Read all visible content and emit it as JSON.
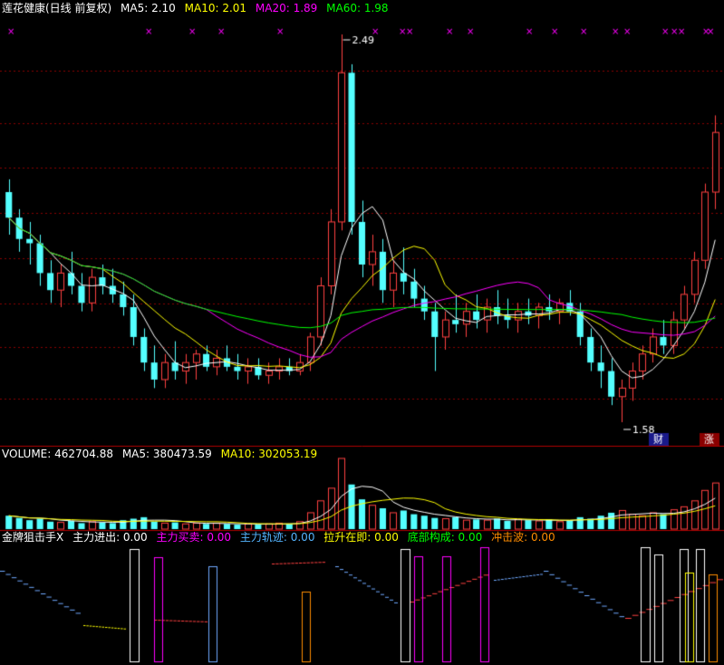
{
  "header": {
    "title": "莲花健康(日线 前复权)",
    "ma5": "MA5: 2.10",
    "ma10": "MA10: 2.01",
    "ma20": "MA20: 1.89",
    "ma60": "MA60: 1.98"
  },
  "volume_header": {
    "volume": "VOLUME: 462704.88",
    "ma5": "MA5: 380473.59",
    "ma10": "MA10: 302053.19"
  },
  "indicator_header": {
    "name": "金牌狙击手X",
    "zljc": "主力进出: 0.00",
    "zlmm": "主力买卖: 0.00",
    "zlgj": "主力轨迹: 0.00",
    "lszj": "拉升在即: 0.00",
    "dbgc": "底部构成: 0.00",
    "cjb": "冲击波: 0.00"
  },
  "annotations": {
    "high_label": "2.49",
    "low_label": "1.58",
    "cai_label": "财",
    "zhang_label": "涨"
  },
  "colors": {
    "up": "#ff4040",
    "down": "#54ffff",
    "ma5": "#ffffff",
    "ma10": "#ffff00",
    "ma20": "#ff00ff",
    "ma60": "#00ff00",
    "grid": "#8b0000",
    "mark": "#ff00ff"
  },
  "chart_data": {
    "type": "candlestick",
    "price_ticks_high": 2.49,
    "price_ticks_low": 1.58,
    "ohlc": [
      [
        2.12,
        2.15,
        2.02,
        2.06
      ],
      [
        2.06,
        2.08,
        1.98,
        2.01
      ],
      [
        2.01,
        2.05,
        1.95,
        2.0
      ],
      [
        2.0,
        2.02,
        1.9,
        1.93
      ],
      [
        1.93,
        1.96,
        1.86,
        1.89
      ],
      [
        1.89,
        1.95,
        1.85,
        1.93
      ],
      [
        1.93,
        1.98,
        1.88,
        1.9
      ],
      [
        1.9,
        1.93,
        1.84,
        1.86
      ],
      [
        1.86,
        1.94,
        1.84,
        1.92
      ],
      [
        1.92,
        1.95,
        1.88,
        1.9
      ],
      [
        1.9,
        1.94,
        1.86,
        1.88
      ],
      [
        1.88,
        1.91,
        1.83,
        1.85
      ],
      [
        1.85,
        1.88,
        1.76,
        1.78
      ],
      [
        1.78,
        1.8,
        1.7,
        1.72
      ],
      [
        1.72,
        1.76,
        1.66,
        1.68
      ],
      [
        1.68,
        1.74,
        1.66,
        1.72
      ],
      [
        1.72,
        1.77,
        1.68,
        1.7
      ],
      [
        1.7,
        1.74,
        1.67,
        1.72
      ],
      [
        1.72,
        1.75,
        1.68,
        1.74
      ],
      [
        1.74,
        1.76,
        1.7,
        1.71
      ],
      [
        1.71,
        1.75,
        1.69,
        1.73
      ],
      [
        1.73,
        1.76,
        1.7,
        1.71
      ],
      [
        1.71,
        1.74,
        1.68,
        1.7
      ],
      [
        1.7,
        1.73,
        1.67,
        1.71
      ],
      [
        1.71,
        1.73,
        1.68,
        1.69
      ],
      [
        1.69,
        1.72,
        1.67,
        1.7
      ],
      [
        1.7,
        1.73,
        1.68,
        1.71
      ],
      [
        1.71,
        1.73,
        1.69,
        1.7
      ],
      [
        1.7,
        1.74,
        1.69,
        1.72
      ],
      [
        1.72,
        1.79,
        1.7,
        1.78
      ],
      [
        1.78,
        1.92,
        1.76,
        1.9
      ],
      [
        1.9,
        2.08,
        1.88,
        2.05
      ],
      [
        2.05,
        2.49,
        2.03,
        2.4
      ],
      [
        2.4,
        2.42,
        2.02,
        2.05
      ],
      [
        2.05,
        2.1,
        1.92,
        1.95
      ],
      [
        1.95,
        2.02,
        1.9,
        1.98
      ],
      [
        1.98,
        2.01,
        1.86,
        1.89
      ],
      [
        1.89,
        1.96,
        1.85,
        1.93
      ],
      [
        1.93,
        1.99,
        1.88,
        1.91
      ],
      [
        1.91,
        1.94,
        1.85,
        1.87
      ],
      [
        1.87,
        1.9,
        1.82,
        1.84
      ],
      [
        1.84,
        1.86,
        1.7,
        1.78
      ],
      [
        1.78,
        1.84,
        1.75,
        1.82
      ],
      [
        1.82,
        1.88,
        1.79,
        1.81
      ],
      [
        1.81,
        1.86,
        1.78,
        1.84
      ],
      [
        1.84,
        1.88,
        1.8,
        1.82
      ],
      [
        1.82,
        1.87,
        1.79,
        1.85
      ],
      [
        1.85,
        1.89,
        1.81,
        1.83
      ],
      [
        1.83,
        1.87,
        1.8,
        1.82
      ],
      [
        1.82,
        1.86,
        1.79,
        1.84
      ],
      [
        1.84,
        1.87,
        1.81,
        1.83
      ],
      [
        1.83,
        1.86,
        1.8,
        1.85
      ],
      [
        1.85,
        1.88,
        1.82,
        1.84
      ],
      [
        1.84,
        1.87,
        1.81,
        1.86
      ],
      [
        1.86,
        1.89,
        1.83,
        1.84
      ],
      [
        1.84,
        1.86,
        1.76,
        1.78
      ],
      [
        1.78,
        1.8,
        1.7,
        1.72
      ],
      [
        1.72,
        1.76,
        1.66,
        1.7
      ],
      [
        1.7,
        1.73,
        1.62,
        1.64
      ],
      [
        1.64,
        1.68,
        1.58,
        1.66
      ],
      [
        1.66,
        1.72,
        1.63,
        1.7
      ],
      [
        1.7,
        1.76,
        1.68,
        1.74
      ],
      [
        1.74,
        1.8,
        1.72,
        1.78
      ],
      [
        1.78,
        1.82,
        1.74,
        1.76
      ],
      [
        1.76,
        1.84,
        1.74,
        1.82
      ],
      [
        1.82,
        1.9,
        1.8,
        1.88
      ],
      [
        1.88,
        1.98,
        1.86,
        1.96
      ],
      [
        1.96,
        2.14,
        1.94,
        2.12
      ],
      [
        2.12,
        2.3,
        2.08,
        2.26
      ]
    ],
    "volume": [
      0.18,
      0.15,
      0.12,
      0.14,
      0.1,
      0.09,
      0.11,
      0.08,
      0.1,
      0.09,
      0.08,
      0.12,
      0.14,
      0.16,
      0.1,
      0.08,
      0.09,
      0.07,
      0.08,
      0.07,
      0.08,
      0.07,
      0.06,
      0.07,
      0.06,
      0.07,
      0.08,
      0.07,
      0.1,
      0.22,
      0.38,
      0.55,
      0.95,
      0.6,
      0.4,
      0.32,
      0.28,
      0.22,
      0.25,
      0.2,
      0.18,
      0.15,
      0.14,
      0.16,
      0.12,
      0.13,
      0.12,
      0.14,
      0.11,
      0.13,
      0.12,
      0.11,
      0.13,
      0.1,
      0.12,
      0.16,
      0.14,
      0.18,
      0.22,
      0.25,
      0.2,
      0.18,
      0.22,
      0.2,
      0.26,
      0.3,
      0.38,
      0.52,
      0.62
    ]
  }
}
